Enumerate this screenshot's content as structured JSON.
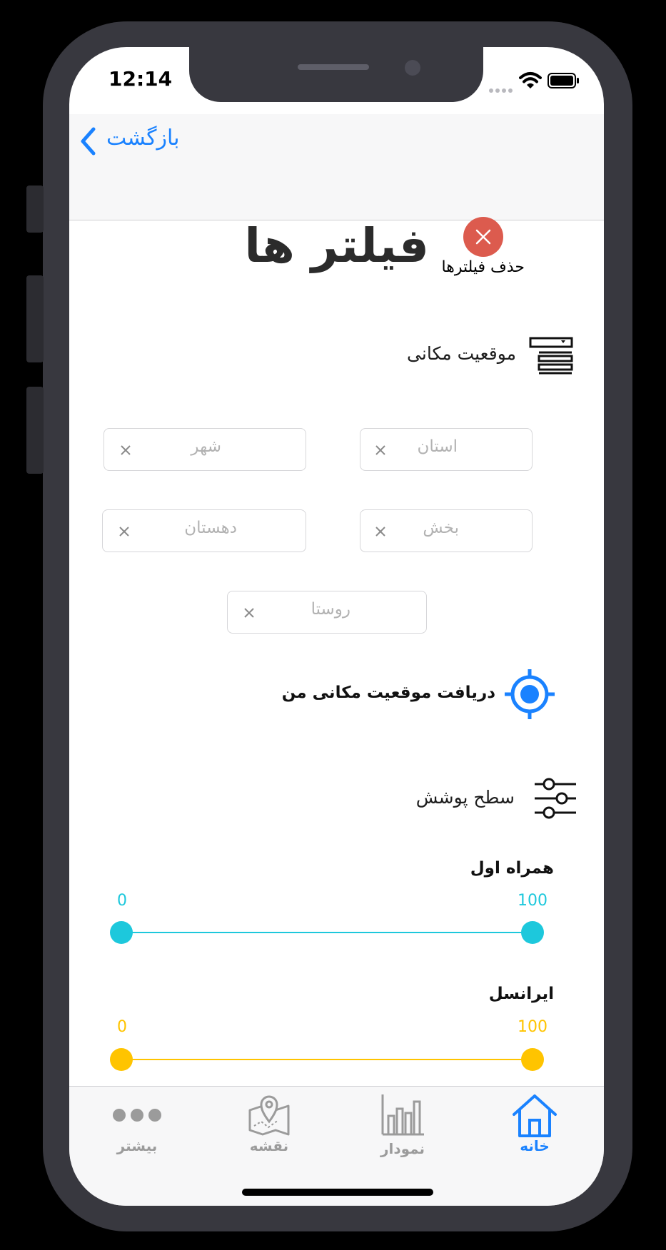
{
  "status_bar": {
    "time": "12:14"
  },
  "nav": {
    "back_label": "بازگشت"
  },
  "header": {
    "title": "فیلتر ها",
    "clear_filters_label": "حذف فیلترها"
  },
  "location_section": {
    "label": "موقعیت مکانی",
    "fields": {
      "province": "استان",
      "city": "شهر",
      "district": "بخش",
      "rural_district": "دهستان",
      "village": "روستا"
    },
    "get_location_label": "دریافت موقعیت مکانی من"
  },
  "coverage_section": {
    "label": "سطح پوشش",
    "operators": [
      {
        "name": "همراه اول",
        "min": "0",
        "max": "100",
        "color": "#1dc8dc"
      },
      {
        "name": "ایرانسل",
        "min": "0",
        "max": "100",
        "color": "#ffc400"
      }
    ]
  },
  "tabbar": {
    "more": "بیشتر",
    "map": "نقشه",
    "chart": "نمودار",
    "home": "خانه",
    "active_color": "#1a82ff"
  }
}
